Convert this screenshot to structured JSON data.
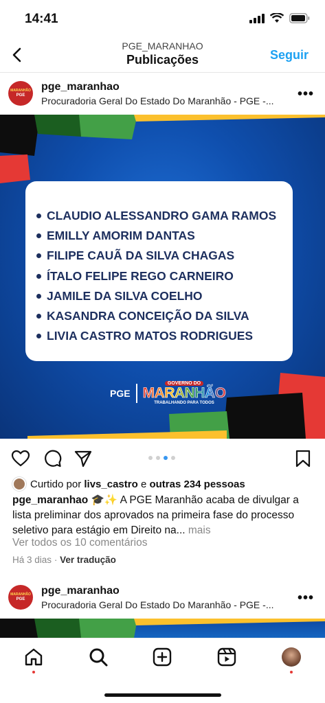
{
  "status_bar": {
    "time": "14:41"
  },
  "header": {
    "username": "PGE_MARANHAO",
    "title": "Publicações",
    "follow_label": "Seguir"
  },
  "post": {
    "username": "pge_maranhao",
    "subtitle": "Procuradoria Geral Do Estado Do Maranhão - PGE -...",
    "avatar_logo": {
      "line1": "MARANHÃO",
      "line2": "PGE"
    },
    "image": {
      "names": [
        "CLAUDIO ALESSANDRO GAMA RAMOS",
        "EMILLY AMORIM DANTAS",
        "FILIPE CAUÃ DA SILVA CHAGAS",
        "ÍTALO FELIPE REGO CARNEIRO",
        "JAMILE DA SILVA COELHO",
        "KASANDRA CONCEIÇÃO DA SILVA",
        "LIVIA CASTRO MATOS RODRIGUES"
      ],
      "logo_pge": "PGE",
      "logo_gov_top": "GOVERNO DO",
      "logo_gov_main": "MARANHÃO",
      "logo_gov_bottom": "TRABALHANDO PARA TODOS"
    },
    "carousel": {
      "count": 4,
      "active_index": 2
    },
    "likes": {
      "prefix": "Curtido por",
      "user": "livs_castro",
      "middle": "e",
      "others": "outras 234 pessoas"
    },
    "caption": {
      "username": "pge_maranhao",
      "emoji": "🎓✨",
      "text": "A PGE Maranhão acaba de divulgar a lista preliminar dos aprovados na primeira fase do processo seletivo para estágio em Direito na...",
      "more_label": "mais"
    },
    "comments_label": "Ver todos os 10 comentários",
    "time_ago": "Há 3 dias",
    "separator": "·",
    "translate_label": "Ver tradução"
  },
  "next_post": {
    "username": "pge_maranhao",
    "subtitle": "Procuradoria Geral Do Estado Do Maranhão - PGE -...",
    "avatar_logo": {
      "line1": "MARANHÃO",
      "line2": "PGE"
    }
  },
  "tabbar": {
    "items": [
      "home",
      "search",
      "create",
      "reels",
      "profile"
    ]
  }
}
